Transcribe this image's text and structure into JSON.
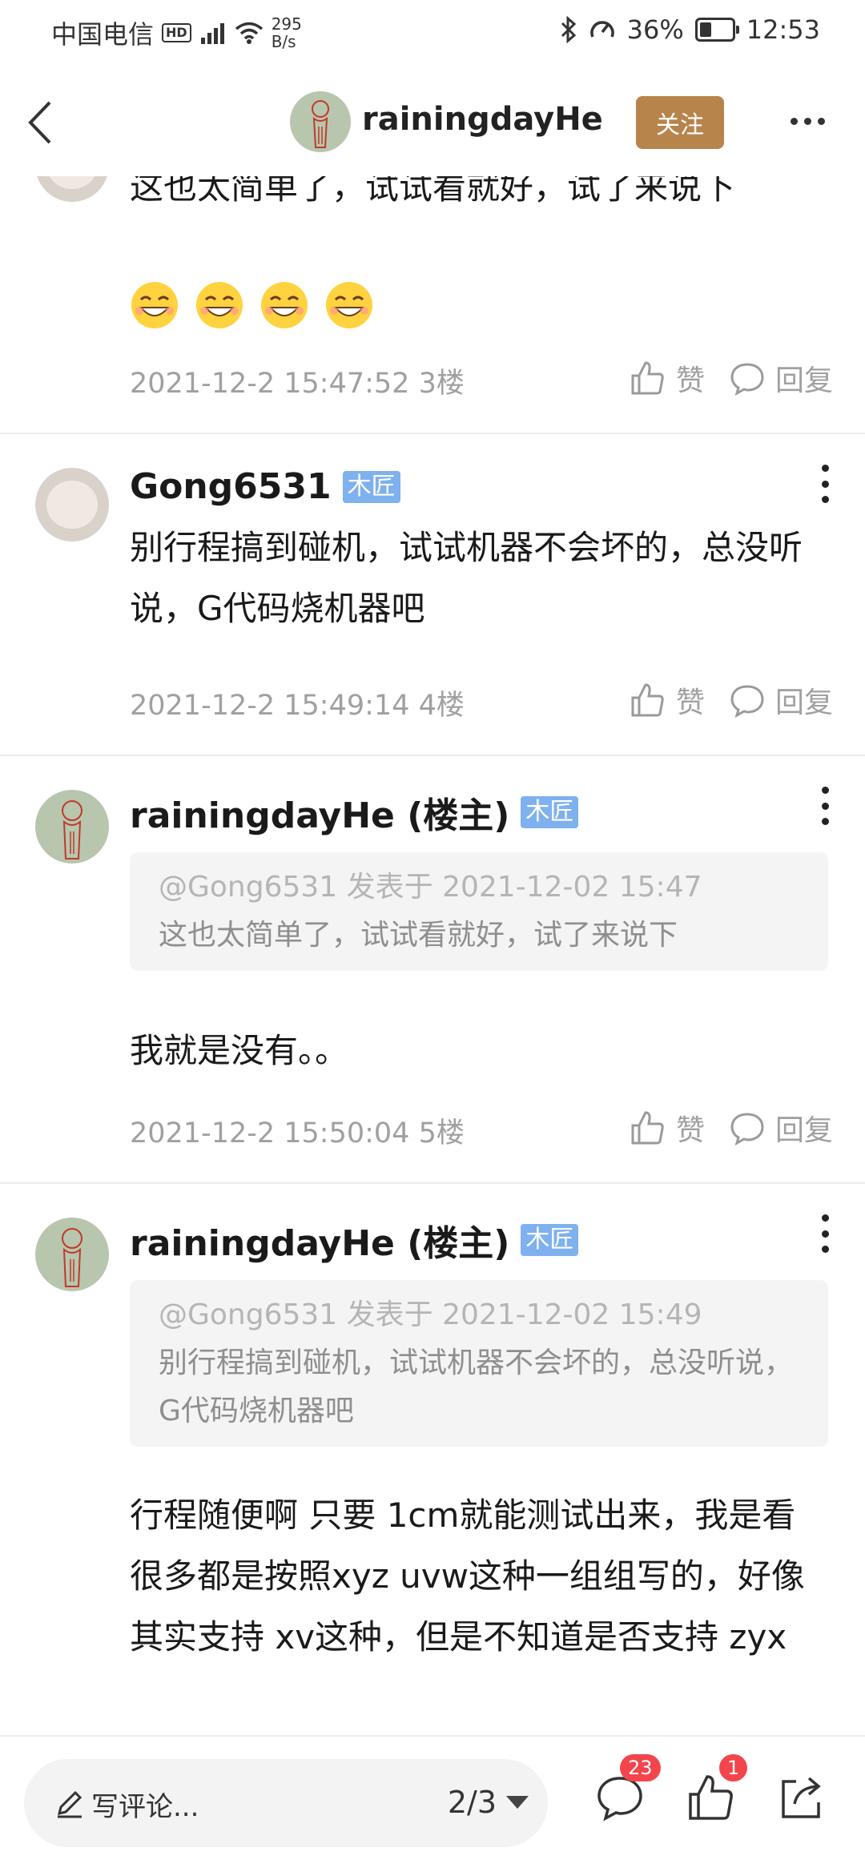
{
  "status_bar": {
    "carrier": "中国电信",
    "hd": "HD",
    "net_speed_value": "295",
    "net_speed_unit": "B/s",
    "battery": "36%",
    "battery_level": 0.36,
    "time": "12:53"
  },
  "header": {
    "title": "rainingdayHe",
    "follow_label": "关注"
  },
  "posts": [
    {
      "username": "",
      "content": "这也太简单了，试试看就好，试了来说下",
      "emoji_count": 4,
      "meta": "2021-12-2 15:47:52  3楼",
      "like_label": "赞",
      "reply_label": "回复"
    },
    {
      "username": "Gong6531",
      "role": "木匠",
      "content": "别行程搞到碰机，试试机器不会坏的，总没听说，G代码烧机器吧",
      "meta": "2021-12-2 15:49:14  4楼",
      "like_label": "赞",
      "reply_label": "回复"
    },
    {
      "username": "rainingdayHe (楼主)",
      "role": "木匠",
      "quote_meta": "@Gong6531 发表于 2021-12-02 15:47",
      "quote_text": "这也太简单了，试试看就好，试了来说下",
      "content": "我就是没有。。",
      "meta": "2021-12-2 15:50:04  5楼",
      "like_label": "赞",
      "reply_label": "回复"
    },
    {
      "username": "rainingdayHe (楼主)",
      "role": "木匠",
      "quote_meta": "@Gong6531 发表于 2021-12-02 15:49",
      "quote_text": "别行程搞到碰机，试试机器不会坏的，总没听说，G代码烧机器吧",
      "content": "行程随便啊 只要 1cm就能测试出来，我是看很多都是按照xyz uvw这种一组组写的，好像其实支持 xv这种，但是不知道是否支持 zyx"
    }
  ],
  "bottom_bar": {
    "comment_placeholder": "写评论...",
    "page_indicator": "2/3",
    "comment_count": "23",
    "like_count": "1"
  },
  "colors": {
    "follow_button": "#b7844b",
    "role_badge": "#7eb1ee",
    "notification_badge": "#f2454c"
  }
}
